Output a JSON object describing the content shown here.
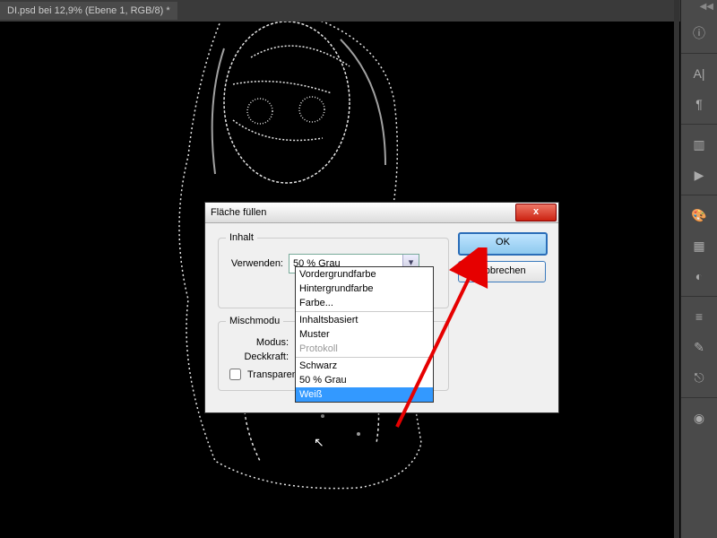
{
  "tab": "DI.psd bei 12,9% (Ebene 1, RGB/8) *",
  "dlg": {
    "title": "Fläche füllen",
    "g1": "Inhalt",
    "r1": "Verwenden:",
    "sel": "50 % Grau",
    "g2": "Mischmodu",
    "r2": "Modus:",
    "r3": "Deckkraft:",
    "cb": "Transparen",
    "ok": "OK",
    "cancel": "Abbrechen"
  },
  "dd": {
    "o1": "Vordergrundfarbe",
    "o2": "Hintergrundfarbe",
    "o3": "Farbe...",
    "o4": "Inhaltsbasiert",
    "o5": "Muster",
    "o6": "Protokoll",
    "o7": "Schwarz",
    "o8": "50 % Grau",
    "o9": "Weiß"
  }
}
